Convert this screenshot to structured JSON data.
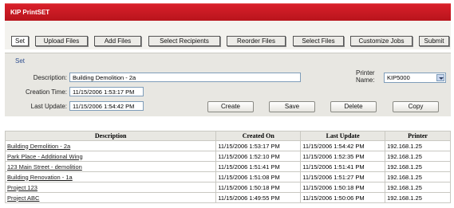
{
  "app": {
    "title": "KIP PrintSET"
  },
  "tabs": [
    {
      "label": "Set"
    },
    {
      "label": "Upload Files"
    },
    {
      "label": "Add Files"
    },
    {
      "label": "Select Recipients"
    },
    {
      "label": "Reorder Files"
    },
    {
      "label": "Select Files"
    },
    {
      "label": "Customize Jobs"
    },
    {
      "label": "Submit"
    }
  ],
  "form": {
    "section_label": "Set",
    "description_label": "Description:",
    "description_value": "Building Demolition - 2a",
    "creation_label": "Creation Time:",
    "creation_value": "11/15/2006 1:53:17 PM",
    "update_label": "Last Update:",
    "update_value": "11/15/2006 1:54:42 PM",
    "printer_label_1": "Printer",
    "printer_label_2": "Name:",
    "printer_value": "KIP5000"
  },
  "buttons": {
    "create": "Create",
    "save": "Save",
    "delete": "Delete",
    "copy": "Copy"
  },
  "table": {
    "headers": [
      "Description",
      "Created On",
      "Last Update",
      "Printer"
    ],
    "rows": [
      [
        "Building Demolition - 2a",
        "11/15/2006 1:53:17 PM",
        "11/15/2006 1:54:42 PM",
        "192.168.1.25"
      ],
      [
        "Park Place - Additional Wing",
        "11/15/2006 1:52:10 PM",
        "11/15/2006 1:52:35 PM",
        "192.168.1.25"
      ],
      [
        "123 Main Street - demolition",
        "11/15/2006 1:51:41 PM",
        "11/15/2006 1:51:41 PM",
        "192.168.1.25"
      ],
      [
        "Building Renovation - 1a",
        "11/15/2006 1:51:08 PM",
        "11/15/2006 1:51:27 PM",
        "192.168.1.25"
      ],
      [
        "Project 123",
        "11/15/2006 1:50:18 PM",
        "11/15/2006 1:50:18 PM",
        "192.168.1.25"
      ],
      [
        "Project ABC",
        "11/15/2006 1:49:55 PM",
        "11/15/2006 1:50:06 PM",
        "192.168.1.25"
      ]
    ]
  }
}
